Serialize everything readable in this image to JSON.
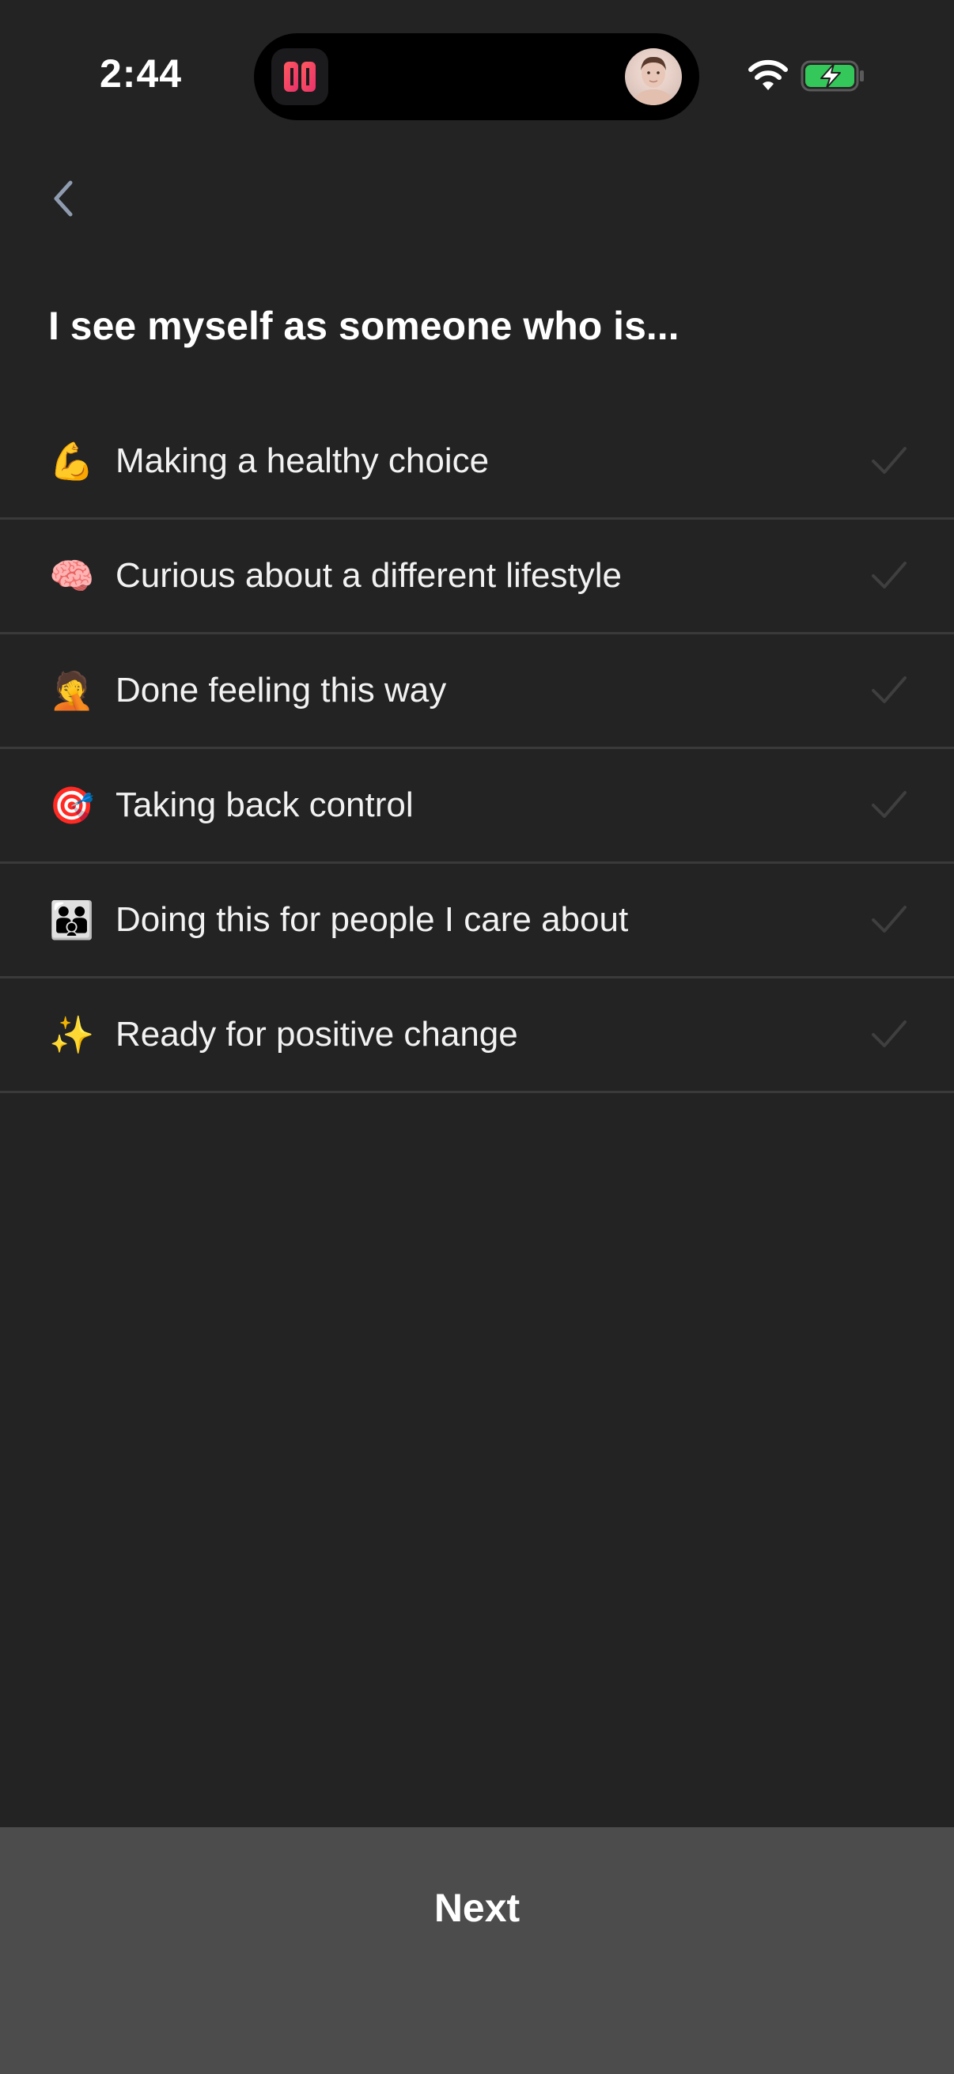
{
  "status_bar": {
    "time": "2:44"
  },
  "nav": {
    "back_icon": "chevron-left-icon"
  },
  "page": {
    "title": "I see myself as someone who is..."
  },
  "options": [
    {
      "emoji": "💪",
      "label": "Making a healthy choice",
      "selected": false
    },
    {
      "emoji": "🧠",
      "label": "Curious about a different lifestyle",
      "selected": false
    },
    {
      "emoji": "🤦",
      "label": "Done feeling this way",
      "selected": false
    },
    {
      "emoji": "🎯",
      "label": "Taking back control",
      "selected": false
    },
    {
      "emoji": "👪",
      "label": "Doing this for people I care about",
      "selected": false
    },
    {
      "emoji": "✨",
      "label": "Ready for positive change",
      "selected": false
    }
  ],
  "footer": {
    "next_label": "Next"
  },
  "colors": {
    "background": "#232323",
    "divider": "#3a3a3a",
    "button": "#4c4c4c",
    "check_unselected": "#3f3f3f",
    "battery_green": "#34c759"
  }
}
